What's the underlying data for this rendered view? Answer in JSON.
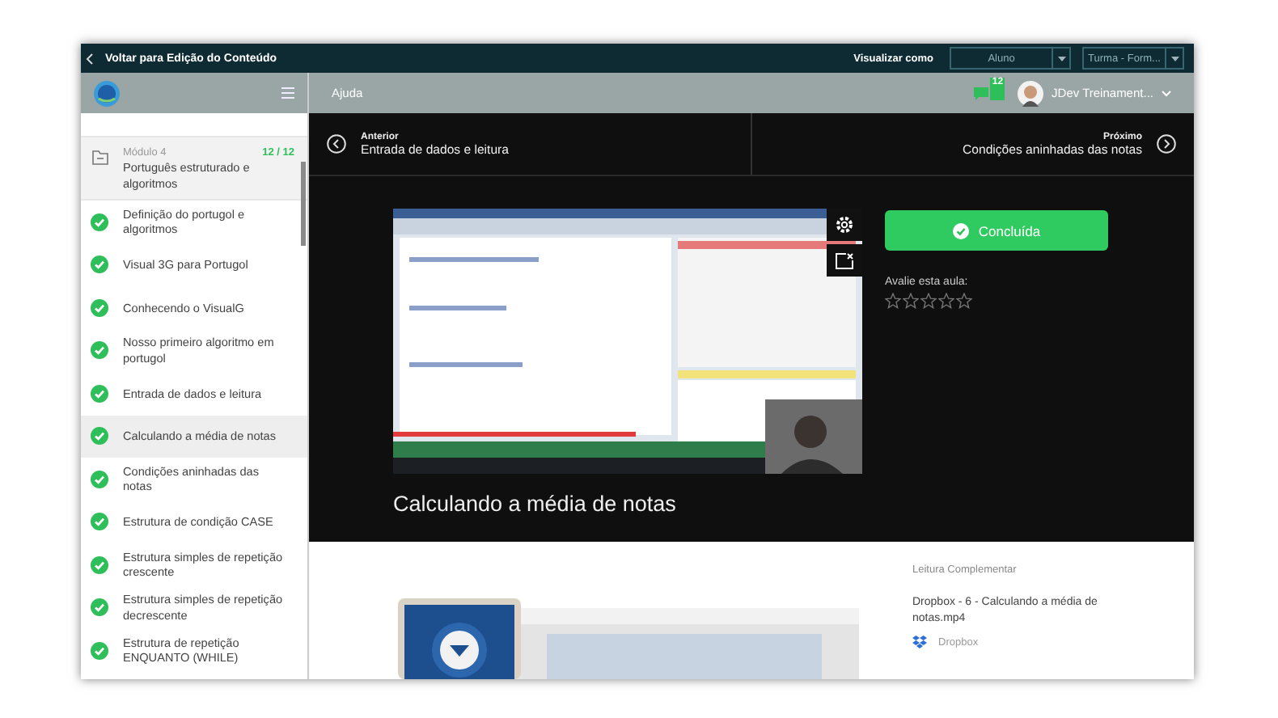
{
  "topbar": {
    "back_label": "Voltar para Edição do Conteúdo",
    "view_as_label": "Visualizar como",
    "selects": [
      "Aluno",
      "Turma - Form..."
    ]
  },
  "header": {
    "help": "Ajuda",
    "notification_count": "12",
    "user_name": "JDev Treinament..."
  },
  "sidebar": {
    "module": {
      "label": "Módulo 4",
      "progress": "12 / 12",
      "complete": true,
      "title": "Português estruturado e algoritmos"
    },
    "lessons": [
      {
        "title": "Definição do portugol e algoritmos",
        "completed": true,
        "selected": false
      },
      {
        "title": "Visual 3G para Portugol",
        "completed": true,
        "selected": false
      },
      {
        "title": "Conhecendo o VisualG",
        "completed": true,
        "selected": false
      },
      {
        "title": "Nosso primeiro algoritmo em portugol",
        "completed": true,
        "selected": false
      },
      {
        "title": "Entrada de dados e leitura",
        "completed": true,
        "selected": false
      },
      {
        "title": "Calculando a média de notas",
        "completed": true,
        "selected": true
      },
      {
        "title": "Condições aninhadas das notas",
        "completed": true,
        "selected": false
      },
      {
        "title": "Estrutura de condição CASE",
        "completed": true,
        "selected": false
      },
      {
        "title": "Estrutura simples de repetição crescente",
        "completed": true,
        "selected": false
      },
      {
        "title": "Estrutura simples de repetição decrescente",
        "completed": true,
        "selected": false
      },
      {
        "title": "Estrutura de repetição ENQUANTO (WHILE)",
        "completed": true,
        "selected": false
      }
    ]
  },
  "nav": {
    "previous": {
      "label": "Anterior",
      "title": "Entrada de dados e leitura"
    },
    "next": {
      "label": "Próximo",
      "title": "Condições aninhadas das notas"
    }
  },
  "lesson": {
    "title": "Calculando a média de notas",
    "complete_button": "Concluída",
    "rating": {
      "label": "Avalie esta aula:",
      "stars": 0
    }
  },
  "complementary": {
    "heading": "Leitura Complementar",
    "file_name": "Dropbox - 6 - Calculando a média de notas.mp4",
    "source": "Dropbox"
  }
}
